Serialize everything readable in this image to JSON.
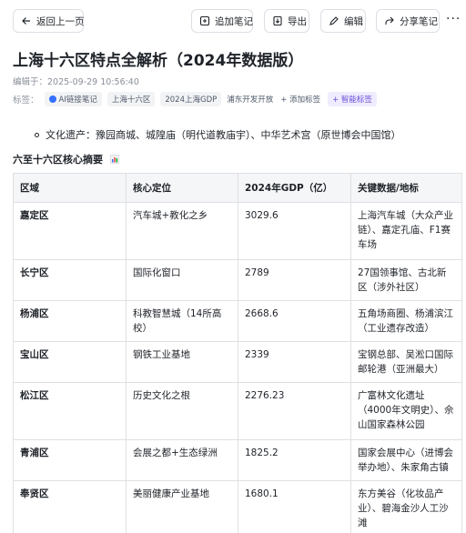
{
  "toolbar": {
    "back_label": "返回上一页",
    "add_note_label": "追加笔记",
    "export_label": "导出",
    "edit_label": "编辑",
    "share_label": "分享笔记",
    "more_label": "···"
  },
  "page": {
    "title": "上海十六区特点全解析（2024年数据版）",
    "edited_at": "编辑于：2025-09-29 10:56:40",
    "tags_label": "标签：",
    "tags": [
      "AI链接笔记",
      "上海十六区",
      "2024上海GDP",
      "浦东开发开放"
    ],
    "add_tag_label": "+ 添加标签",
    "smart_tag_label": "+ 智能标签"
  },
  "content": {
    "bullet_text": "文化遗产：豫园商城、城隍庙（明代道教庙宇）、中华艺术宫（原世博会中国馆）",
    "section_title": "六至十六区核心摘要"
  },
  "table": {
    "headers": [
      "区域",
      "核心定位",
      "2024年GDP（亿）",
      "关键数据/地标"
    ],
    "rows": [
      [
        "嘉定区",
        "汽车城+教化之乡",
        "3029.6",
        "上海汽车城（大众产业链）、嘉定孔庙、F1赛车场"
      ],
      [
        "长宁区",
        "国际化窗口",
        "2789",
        "27国领事馆、古北新区（涉外社区）"
      ],
      [
        "杨浦区",
        "科教智慧城（14所高校）",
        "2668.6",
        "五角场商圈、杨浦滨江（工业遗存改造）"
      ],
      [
        "宝山区",
        "钢铁工业基地",
        "2339",
        "宝钢总部、吴淞口国际邮轮港（亚洲最大）"
      ],
      [
        "松江区",
        "历史文化之根",
        "2276.23",
        "广富林文化遗址（4000年文明史）、佘山国家森林公园"
      ],
      [
        "青浦区",
        "会展之都+生态绿洲",
        "1825.2",
        "国家会展中心（进博会举办地）、朱家角古镇"
      ],
      [
        "奉贤区",
        "美丽健康产业基地",
        "1680.1",
        "东方美谷（化妆品产业）、碧海金沙人工沙滩"
      ]
    ]
  },
  "colors": {
    "accent": "#3370ff",
    "ai_tag": "#6b4fd8",
    "border": "#dee0e3",
    "header_bg": "#f5f6f7"
  },
  "icons": {
    "back": "arrow-left-icon",
    "add_note": "note-plus-icon",
    "export": "export-icon",
    "edit": "pencil-icon",
    "share": "share-icon",
    "section": "bar-chart-icon"
  }
}
